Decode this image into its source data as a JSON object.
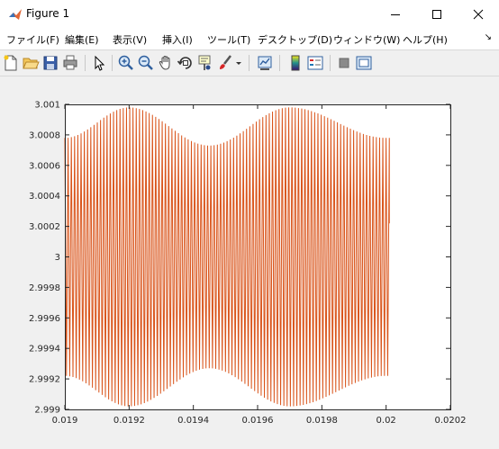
{
  "window": {
    "title": "Figure 1",
    "colors": {
      "series": "#d95319",
      "axes_bg": "#ffffff",
      "figure_bg": "#f0f0f0"
    }
  },
  "menu": {
    "items": [
      {
        "label": "ファイル(F)"
      },
      {
        "label": "編集(E)"
      },
      {
        "label": "表示(V)"
      },
      {
        "label": "挿入(I)"
      },
      {
        "label": "ツール(T)"
      },
      {
        "label": "デスクトップ(D)"
      },
      {
        "label": "ウィンドウ(W)"
      },
      {
        "label": "ヘルプ(H)"
      }
    ]
  },
  "toolbar": {
    "icons": [
      "new-figure-icon",
      "open-file-icon",
      "save-icon",
      "print-icon",
      "pointer-icon",
      "zoom-in-icon",
      "zoom-out-icon",
      "pan-icon",
      "rotate-icon",
      "data-cursor-icon",
      "brush-icon",
      "link-plot-icon",
      "colorbar-icon",
      "legend-icon",
      "hide-plot-tools-icon",
      "show-plot-tools-icon"
    ]
  },
  "chart_data": {
    "type": "line",
    "title": "",
    "xlabel": "",
    "ylabel": "",
    "xlim": [
      0.019,
      0.0202
    ],
    "ylim": [
      2.999,
      3.001
    ],
    "x_tick_labels": [
      "0.019",
      "0.0192",
      "0.0194",
      "0.0196",
      "0.0198",
      "0.02",
      "0.0202"
    ],
    "y_tick_labels": [
      "2.999",
      "2.9992",
      "2.9994",
      "2.9996",
      "2.9998",
      "3",
      "3.0002",
      "3.0004",
      "3.0006",
      "3.0008",
      "3.001"
    ],
    "series": [
      {
        "color": "#d95319",
        "x_start": 0.019,
        "x_end": 0.02001,
        "oscillation_cycles": 100,
        "mean": 3.0,
        "envelope_points": [
          {
            "x": 0.019,
            "amp": 0.00078
          },
          {
            "x": 0.0192,
            "amp": 0.00098
          },
          {
            "x": 0.01945,
            "amp": 0.00073
          },
          {
            "x": 0.0197,
            "amp": 0.00098
          },
          {
            "x": 0.02,
            "amp": 0.00078
          }
        ],
        "end_value": 3.00022
      }
    ]
  }
}
